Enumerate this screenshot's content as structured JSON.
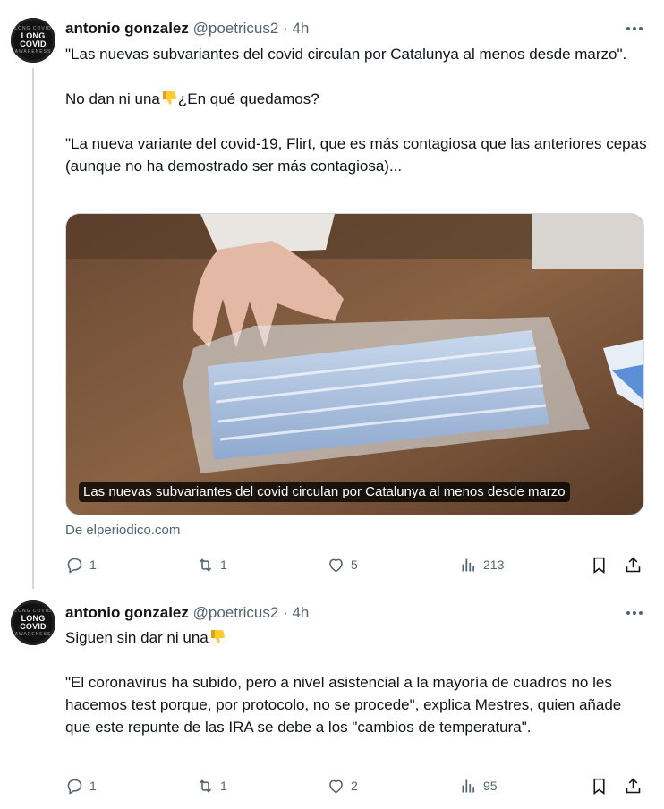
{
  "tweets": [
    {
      "author": {
        "name": "antonio gonzalez",
        "handle": "@poetricus2",
        "time": "4h",
        "separator": "·",
        "avatar": {
          "ring_top": "LONG COVID",
          "line1": "LONG",
          "line2": "COVID",
          "ring_bottom": "AWARENESS"
        }
      },
      "paragraphs": [
        "\"Las nuevas subvariantes del covid circulan por Catalunya al menos desde marzo\".",
        "No dan ni una",
        "¿En qué quedamos?",
        "\"La nueva variante del covid-19, Flirt, que es más contagiosa que las anteriores cepas (aunque no ha demostrado ser más contagiosa)..."
      ],
      "emoji": "thumbs-down-icon",
      "card": {
        "caption": "Las nuevas subvariantes del covid circulan por Catalunya al menos desde marzo",
        "source": "De elperiodico.com"
      },
      "stats": {
        "replies": "1",
        "reposts": "1",
        "likes": "5",
        "views": "213"
      }
    },
    {
      "author": {
        "name": "antonio gonzalez",
        "handle": "@poetricus2",
        "time": "4h",
        "separator": "·",
        "avatar": {
          "ring_top": "LONG COVID",
          "line1": "LONG",
          "line2": "COVID",
          "ring_bottom": "AWARENESS"
        }
      },
      "paragraphs": [
        "Siguen sin dar ni una",
        "\"El coronavirus ha subido, pero a nivel asistencial a la mayoría de cuadros no les hacemos test porque, por protocolo, no se procede\", explica Mestres, quien añade que este repunte de las IRA se debe a los \"cambios de temperatura\"."
      ],
      "emoji": "thumbs-down-icon",
      "stats": {
        "replies": "1",
        "reposts": "1",
        "likes": "2",
        "views": "95"
      }
    }
  ],
  "colors": {
    "text": "#0f1419",
    "secondary": "#536471",
    "divider": "#eff3f4",
    "thread_line": "#cfd9de"
  }
}
